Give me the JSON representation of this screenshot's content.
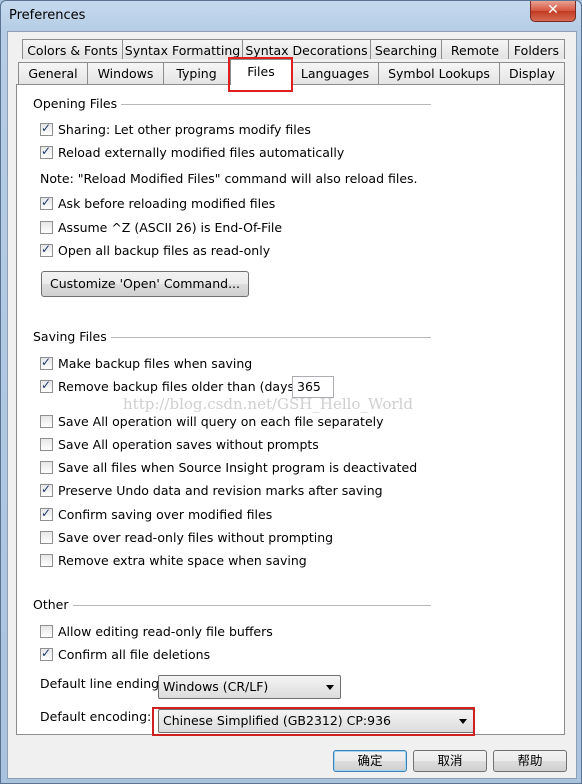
{
  "window": {
    "title": "Preferences",
    "close": "✕"
  },
  "tabs_row1": [
    "Colors & Fonts",
    "Syntax Formatting",
    "Syntax Decorations",
    "Searching",
    "Remote",
    "Folders"
  ],
  "tabs_row2": [
    "General",
    "Windows",
    "Typing",
    "Files",
    "Languages",
    "Symbol Lookups",
    "Display"
  ],
  "active_tab": "Files",
  "opening": {
    "title": "Opening Files",
    "sharing": "Sharing: Let other programs modify files",
    "reload": "Reload externally modified files automatically",
    "note": "Note: \"Reload Modified Files\" command will also reload files.",
    "ask": "Ask before reloading modified files",
    "assume": "Assume ^Z (ASCII 26) is End-Of-File",
    "open_backup": "Open all backup files as read-only",
    "customize_button": "Customize 'Open' Command..."
  },
  "saving": {
    "title": "Saving Files",
    "make_backup": "Make backup files when saving",
    "remove_backup": "Remove backup files older than (days):",
    "remove_days": "365",
    "query_each": "Save All operation will query on each file separately",
    "no_prompts": "Save All operation saves without prompts",
    "deactivated": "Save all files when Source Insight program is deactivated",
    "preserve_undo": "Preserve Undo data and revision marks after saving",
    "confirm_over": "Confirm saving over modified files",
    "readonly_noprompt": "Save over read-only files without prompting",
    "remove_whitespace": "Remove extra white space when saving"
  },
  "other": {
    "title": "Other",
    "allow_readonly": "Allow editing read-only file buffers",
    "confirm_delete": "Confirm all file deletions",
    "line_ending_label": "Default line ending:",
    "line_ending_value": "Windows (CR/LF)",
    "encoding_label": "Default encoding:",
    "encoding_value": "Chinese Simplified (GB2312)  CP:936"
  },
  "watermark": "http://blog.csdn.net/GSH_Hello_World",
  "footer": {
    "ok": "确定",
    "cancel": "取消",
    "help": "帮助"
  }
}
